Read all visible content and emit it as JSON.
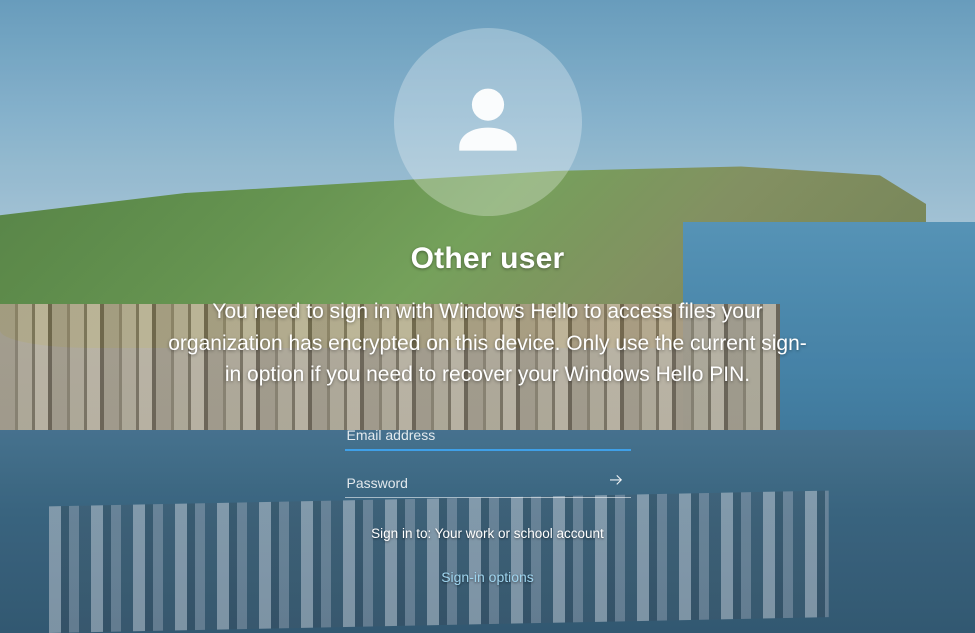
{
  "login": {
    "title": "Other user",
    "message": "You need to sign in with Windows Hello to access files your organization has encrypted on this device. Only use the current sign-in option if you need to recover your Windows Hello PIN.",
    "email": {
      "placeholder": "Email address",
      "value": ""
    },
    "password": {
      "placeholder": "Password",
      "value": ""
    },
    "sign_in_to": "Sign in to: Your work or school account",
    "sign_in_options": "Sign-in options"
  },
  "colors": {
    "accent": "#3fa0e8",
    "link": "#9fd4ee"
  }
}
